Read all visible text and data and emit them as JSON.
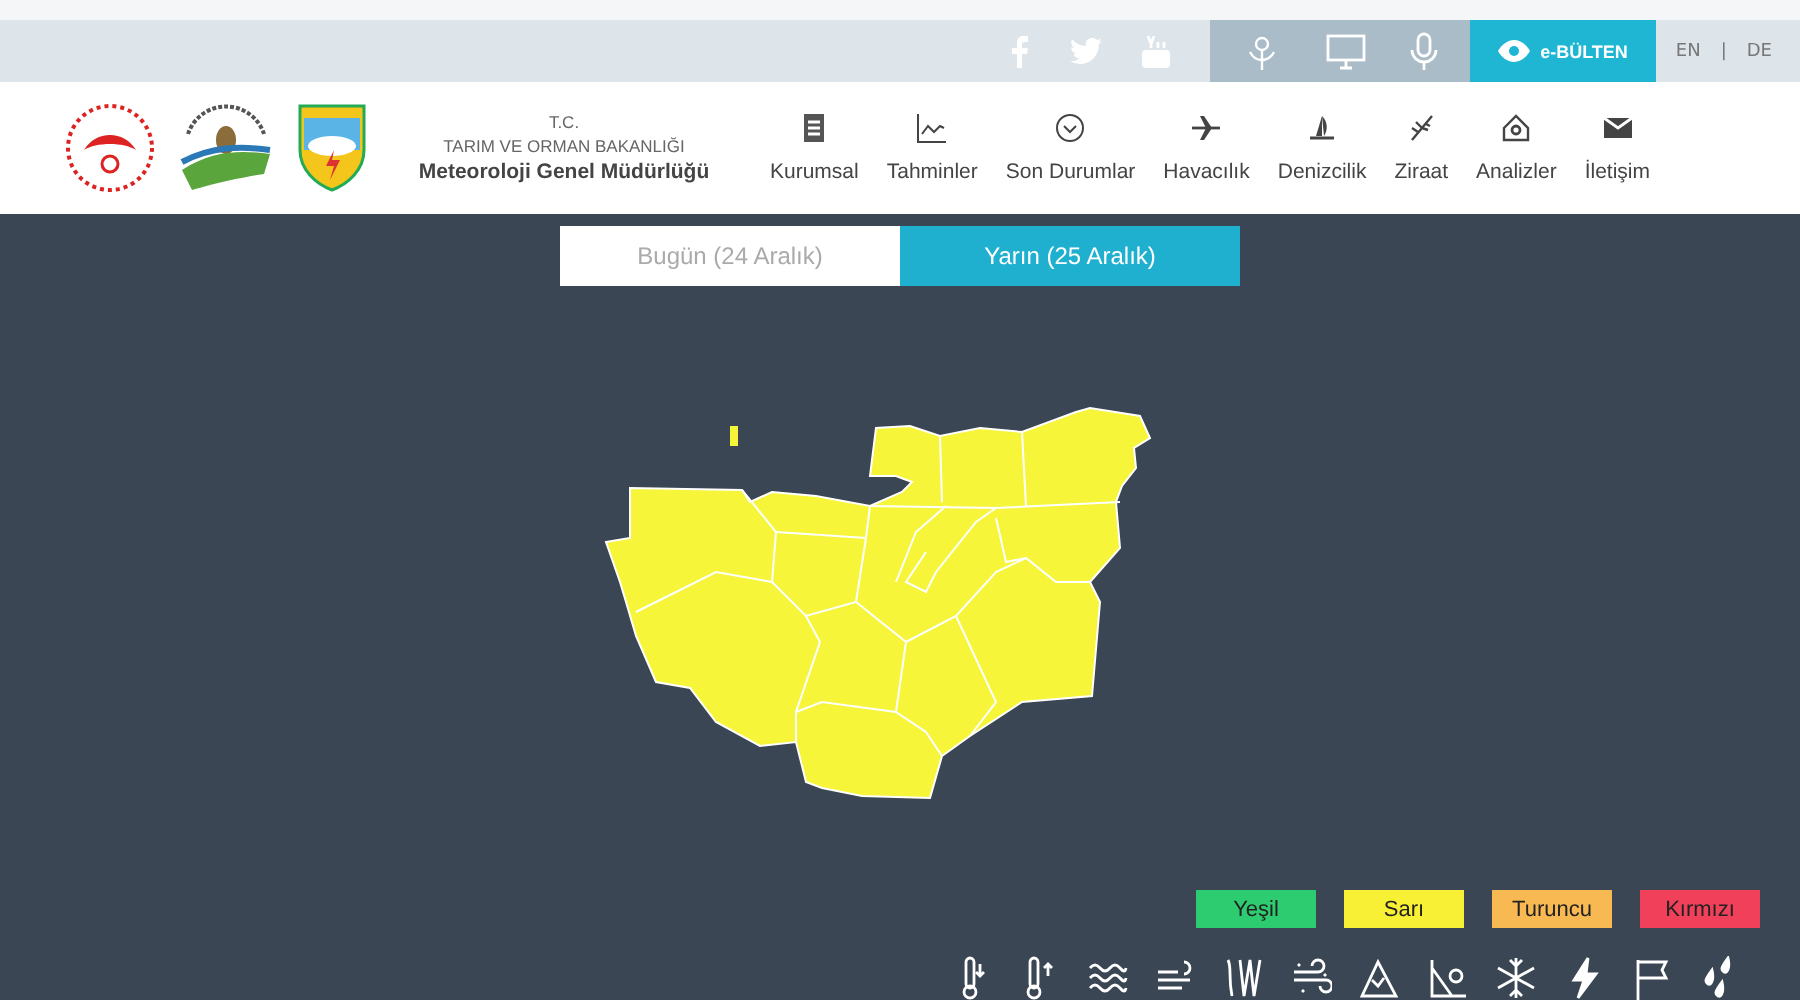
{
  "utility_bar": {
    "ebulten": "e-BÜLTEN",
    "languages": [
      "EN",
      "DE"
    ],
    "separator": "|"
  },
  "header": {
    "org_line_1": "T.C.",
    "org_line_2": "TARIM VE ORMAN BAKANLIĞI",
    "org_line_3": "Meteoroloji Genel Müdürlüğü"
  },
  "nav": [
    {
      "label": "Kurumsal"
    },
    {
      "label": "Tahminler"
    },
    {
      "label": "Son Durumlar"
    },
    {
      "label": "Havacılık"
    },
    {
      "label": "Denizcilik"
    },
    {
      "label": "Ziraat"
    },
    {
      "label": "Analizler"
    },
    {
      "label": "İletişim"
    }
  ],
  "day_tabs": [
    {
      "label": "Bugün (24 Aralık)",
      "selected": false
    },
    {
      "label": "Yarın (25 Aralık)",
      "selected": true
    }
  ],
  "legend": [
    {
      "label": "Yeşil",
      "color": "#2ecc71"
    },
    {
      "label": "Sarı",
      "color": "#f7f034"
    },
    {
      "label": "Turuncu",
      "color": "#f8b952"
    },
    {
      "label": "Kırmızı",
      "color": "#f0405a"
    }
  ]
}
